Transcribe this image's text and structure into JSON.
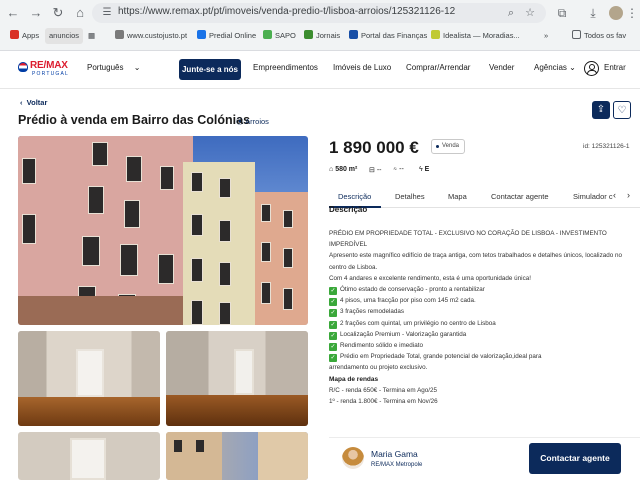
{
  "browser": {
    "url": "https://www.remax.pt/pt/imoveis/venda-predio-t/lisboa-arroios/125321126-12",
    "bookmarks": [
      {
        "label": "Apps",
        "color": "#d93025"
      },
      {
        "label": "anuncios",
        "color": "#9aa0a6"
      },
      {
        "label": "www.custojusto.pt",
        "color": "#7a7a7a"
      },
      {
        "label": "Predial Online",
        "color": "#1a73e8"
      },
      {
        "label": "SAPO",
        "color": "#4caf50"
      },
      {
        "label": "Jornais",
        "color": "#3c8d2f"
      },
      {
        "label": "Portal das Finanças",
        "color": "#174ea6"
      },
      {
        "label": "Idealista — Moradias...",
        "color": "#c0ca33"
      },
      {
        "label": "Todos os fav",
        "color": "#5f6368"
      }
    ],
    "bookmarks_more": "»"
  },
  "header": {
    "logo_text": "RE/MAX",
    "logo_sub": "PORTUGAL",
    "language": "Português",
    "join_label": "Junte-se a nós",
    "nav": [
      "Empreendimentos",
      "Imóveis de Luxo",
      "Comprar/Arrendar",
      "Vender",
      "Agências"
    ],
    "login_label": "Entrar"
  },
  "listing": {
    "back_label": "Voltar",
    "title": "Prédio à venda em Bairro das Colónias",
    "location": "Arroios",
    "price": "1 890 000 €",
    "status": "Venda",
    "reference": "id: 125321126-1",
    "area": "580 m²",
    "bedrooms": "--",
    "bathrooms": "--",
    "energy": "E"
  },
  "tabs": [
    "Descrição",
    "Detalhes",
    "Mapa",
    "Contactar agente",
    "Simulador c"
  ],
  "description": {
    "heading": "Descrição",
    "intro": "PRÉDIO EM PROPRIEDADE TOTAL - EXCLUSIVO NO CORAÇÃO DE LISBOA - INVESTIMENTO IMPERDÍVEL",
    "para1": "Apresento este magnífico edifício de traça antiga, com tetos trabalhados e detalhes únicos, localizado no centro de Lisboa.",
    "para2": "Com 4 andares e excelente rendimento, esta é uma oportunidade única!",
    "checks": [
      "Ótimo estado de conservação - pronto a rentabilizar",
      "4 pisos, uma fracção por piso com 145 m2 cada.",
      "3 frações remodeladas",
      "2 frações com quintal, um privilégio no centro de Lisboa",
      "Localização Premium - Valorização garantida",
      "Rendimento sólido e imediato",
      "Prédio em Propriedade Total, grande potencial de valorização,ideal para"
    ],
    "after_checks": "arrendamento ou projeto exclusivo.",
    "rent_heading": "Mapa de rendas",
    "rents": [
      "R/C - renda 650€ - Termina em Ago/25",
      "1º - renda 1.800€ - Termina em Nov/26"
    ]
  },
  "agent": {
    "name": "Maria Gama",
    "office": "RE/MAX Metropole",
    "contact_label": "Contactar agente"
  }
}
